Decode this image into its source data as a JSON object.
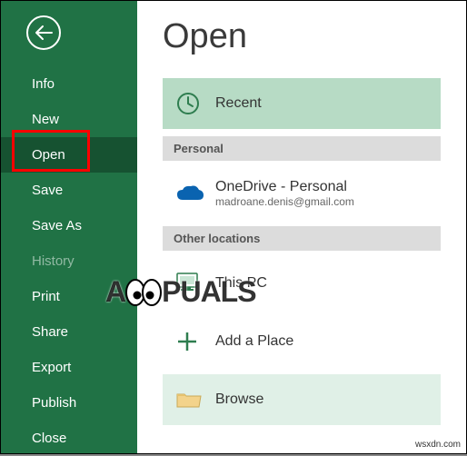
{
  "sidebar": {
    "items": [
      {
        "label": "Info",
        "name": "nav-info"
      },
      {
        "label": "New",
        "name": "nav-new"
      },
      {
        "label": "Open",
        "name": "nav-open",
        "selected": true
      },
      {
        "label": "Save",
        "name": "nav-save"
      },
      {
        "label": "Save As",
        "name": "nav-save-as"
      },
      {
        "label": "History",
        "name": "nav-history",
        "disabled": true
      },
      {
        "label": "Print",
        "name": "nav-print"
      },
      {
        "label": "Share",
        "name": "nav-share"
      },
      {
        "label": "Export",
        "name": "nav-export"
      },
      {
        "label": "Publish",
        "name": "nav-publish"
      },
      {
        "label": "Close",
        "name": "nav-close"
      }
    ]
  },
  "main": {
    "title": "Open",
    "recent_label": "Recent",
    "section_personal": "Personal",
    "onedrive_label": "OneDrive - Personal",
    "onedrive_email": "madroane.denis@gmail.com",
    "section_other": "Other locations",
    "thispc_label": "This PC",
    "addplace_label": "Add a Place",
    "browse_label": "Browse"
  },
  "watermark": {
    "left_before": "A",
    "left_after": "PUALS",
    "right": "wsxdn.com"
  }
}
